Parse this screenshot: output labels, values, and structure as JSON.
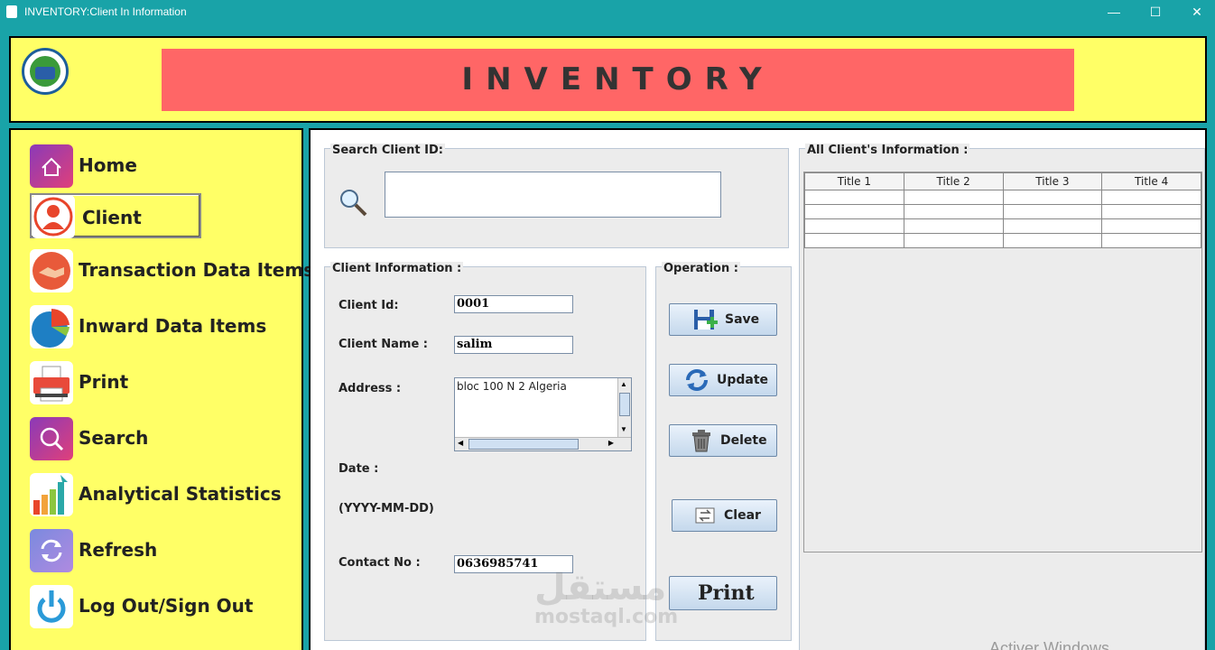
{
  "window": {
    "title": "INVENTORY:Client In Information",
    "minimize": "—",
    "maximize": "☐",
    "close": "✕"
  },
  "header": {
    "banner_text": "INVENTORY",
    "logo": "organization-logo"
  },
  "sidebar": {
    "active": "Client",
    "items": [
      {
        "label": "Home",
        "icon": "home-icon",
        "color": "#c0408a"
      },
      {
        "label": "Client",
        "icon": "user-icon",
        "color": "#e8452b"
      },
      {
        "label": "Transaction Data Items",
        "icon": "handshake-icon",
        "color": "#e85a3a"
      },
      {
        "label": "Inward Data Items",
        "icon": "pie-chart-icon",
        "color": "#1e7fc4"
      },
      {
        "label": "Print",
        "icon": "printer-icon",
        "color": "#e84a3a"
      },
      {
        "label": "Search",
        "icon": "search-icon",
        "color": "#c0408a"
      },
      {
        "label": "Analytical Statistics",
        "icon": "bar-chart-icon",
        "color": "#f2a33a"
      },
      {
        "label": "Refresh",
        "icon": "refresh-icon",
        "color": "#8a8adf"
      },
      {
        "label": "Log Out/Sign Out",
        "icon": "power-icon",
        "color": "#2a9ad8"
      }
    ]
  },
  "search": {
    "title": "Search Client ID:",
    "value": ""
  },
  "client_info": {
    "title": "Client Information :",
    "id_label": "Client Id:",
    "id_value": "0001",
    "name_label": "Client Name :",
    "name_value": "salim",
    "address_label": "Address :",
    "address_value": "bloc 100 N 2 Algeria",
    "date_label": "Date :",
    "date_format": "(YYYY-MM-DD)",
    "contact_label": "Contact No :",
    "contact_value": "0636985741"
  },
  "operation": {
    "title": "Operation :",
    "save": "Save",
    "update": "Update",
    "delete": "Delete",
    "clear": "Clear",
    "print": "Print"
  },
  "all_clients": {
    "title": "All Client's Information :",
    "columns": [
      "Title 1",
      "Title 2",
      "Title 3",
      "Title 4"
    ],
    "row_count": 4
  },
  "watermark": {
    "arabic": "مستقل",
    "latin": "mostaql.com"
  },
  "activation_notice": "Activer Windows"
}
